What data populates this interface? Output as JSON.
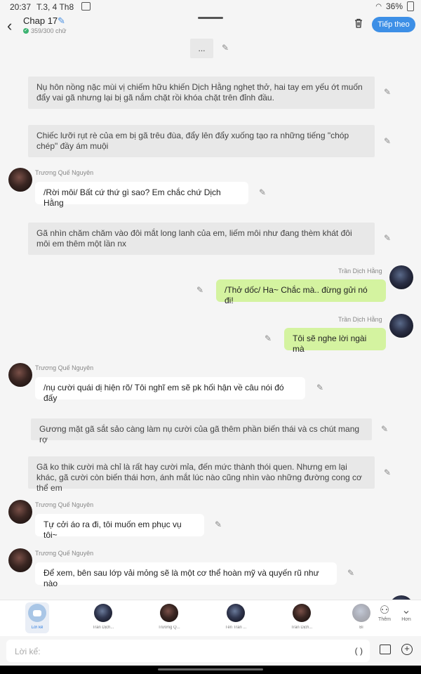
{
  "status_bar": {
    "time": "20:37",
    "date": "T.3, 4 Th8",
    "battery": "36%"
  },
  "header": {
    "title": "Chap 17",
    "word_count": "359/300 chữ",
    "next_button": "Tiếp theo"
  },
  "messages": [
    {
      "type": "narration",
      "text": "..."
    },
    {
      "type": "narration",
      "text": "Nụ hôn nồng nặc mùi vị chiếm hữu khiến Dịch Hằng nghẹt thở, hai tay em yếu ớt muốn đẩy vai gã nhưng lại bị gã nắm chặt rồi khóa chặt trên đỉnh đầu."
    },
    {
      "type": "narration",
      "text": "Chiếc lưỡi rụt rè của em bị gã trêu đùa, đẩy lên đẩy xuống tạo ra những tiếng \"chóp chép\" đầy ám muội"
    },
    {
      "type": "left",
      "name": "Trương Quế Nguyên",
      "text": "/Rời môi/ Bất cứ thứ gì sao? Em chắc chứ Dịch Hằng"
    },
    {
      "type": "narration",
      "text": "Gã nhìn chăm chăm vào đôi mắt long lanh của em, liếm môi như đang thèm khát đôi môi em thêm một lần nx"
    },
    {
      "type": "right",
      "name": "Trần Dịch Hằng",
      "text": "/Thở dốc/ Ha~ Chắc mà.. đừng gửi nó đi!"
    },
    {
      "type": "right",
      "name": "Trần Dịch Hằng",
      "text": "Tôi sẽ nghe lời ngài mà"
    },
    {
      "type": "left",
      "name": "Trương Quế Nguyên",
      "text": "/nụ cười quái dị hiện rõ/ Tôi nghĩ em sẽ pk hối hận về câu nói đó đấy"
    },
    {
      "type": "narration",
      "text": "Gương mặt gã sắt sảo càng làm nụ cười của gã thêm phần biến thái và cs chút mang rợ"
    },
    {
      "type": "narration",
      "text": "Gã ko thik cười mà chỉ là rất hay cười mỉa, đến mức thành thói quen. Nhưng em lại khác, gã cười  còn biến thái hơn, ánh mắt lúc nào cũng nhìn vào những đường cong cơ thể em"
    },
    {
      "type": "left",
      "name": "Trương Quế Nguyên",
      "text": "Tự cởi áo ra đi, tôi muốn em phục vụ tôi~"
    },
    {
      "type": "left",
      "name": "Trương Quế Nguyên",
      "text": "Để xem, bên sau lớp vải mỏng sẽ là một cơ thể hoàn mỹ và quyến rũ như nào"
    }
  ],
  "character_bar": {
    "items": [
      {
        "label": "Lời kể"
      },
      {
        "label": "Trần Dịch..."
      },
      {
        "label": "Trương Q..."
      },
      {
        "label": "Tên Trần ..."
      },
      {
        "label": "Trần Dịch..."
      },
      {
        "label": "Bì"
      }
    ],
    "more_label": "Thêm",
    "collapse_label": "Hơn"
  },
  "input": {
    "placeholder": "Lời kể:",
    "paren": "( )"
  },
  "icons": [
    "back-icon",
    "pencil-icon",
    "check-icon",
    "trash-icon",
    "edit-icon",
    "chat-icon",
    "add-person-icon",
    "chevron-down-icon",
    "image-icon",
    "plus-icon"
  ],
  "colors": {
    "accent": "#3d8fe6",
    "right_bubble": "#d4f3a0",
    "narration_bubble": "#e8e8e8"
  }
}
